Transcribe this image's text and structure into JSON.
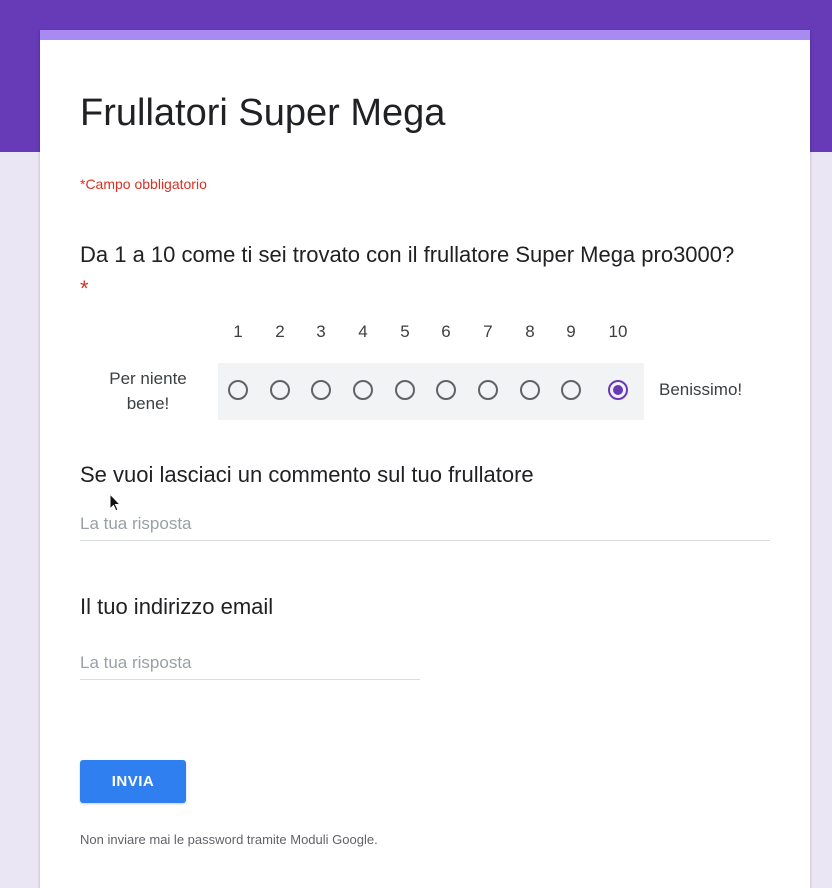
{
  "form": {
    "title": "Frullatori Super Mega",
    "required_note": "*Campo obbligatorio"
  },
  "question1": {
    "title": "Da 1 a 10 come ti sei trovato con il frullatore Super Mega pro3000?",
    "required_marker": "*",
    "scale_numbers": [
      "1",
      "2",
      "3",
      "4",
      "5",
      "6",
      "7",
      "8",
      "9",
      "10"
    ],
    "low_label": "Per niente bene!",
    "high_label": "Benissimo!",
    "selected_value": "10"
  },
  "question2": {
    "title": "Se vuoi lasciaci un commento sul tuo frullatore",
    "placeholder": "La tua risposta",
    "value": ""
  },
  "question3": {
    "title": "Il tuo indirizzo email",
    "placeholder": "La tua risposta",
    "value": ""
  },
  "submit": {
    "label": "INVIA"
  },
  "footer": {
    "note": "Non inviare mai le password tramite Moduli Google."
  },
  "icons": {
    "cursor": "mouse-pointer-icon"
  },
  "colors": {
    "header_bg": "#673ab7",
    "card_accent": "#a78bf0",
    "required_red": "#d93025",
    "submit_blue": "#2f7ff0",
    "radio_selected": "#673ab7"
  }
}
